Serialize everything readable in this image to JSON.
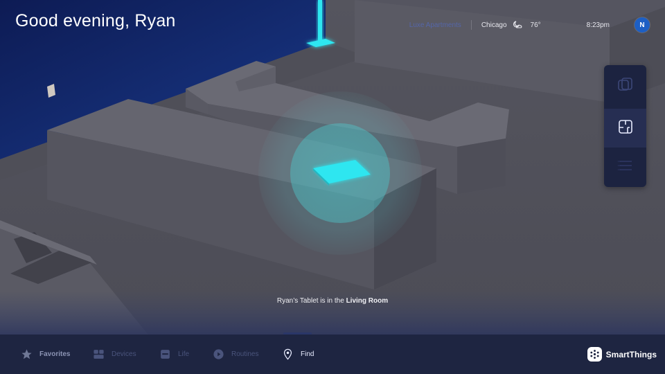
{
  "greeting": "Good evening, Ryan",
  "header": {
    "location": "Luxe Apartments",
    "city": "Chicago",
    "weather_icon": "moon-cloud-icon",
    "temperature": "76°",
    "time": "8:23pm",
    "avatar_initial": "N"
  },
  "side_panel": {
    "buttons": [
      {
        "icon": "layers-icon",
        "state": "dim"
      },
      {
        "icon": "floor-plan-icon",
        "state": "active"
      },
      {
        "icon": "list-icon",
        "state": "dim"
      }
    ]
  },
  "find": {
    "caption_prefix": "Ryan’s Tablet is in the",
    "room": "Living Room"
  },
  "nav": {
    "items": [
      {
        "label": "Favorites",
        "icon": "star-icon"
      },
      {
        "label": "Devices",
        "icon": "devices-icon"
      },
      {
        "label": "Life",
        "icon": "life-icon"
      },
      {
        "label": "Routines",
        "icon": "play-icon"
      },
      {
        "label": "Find",
        "icon": "location-pin-icon"
      }
    ],
    "selected": "Find"
  },
  "brand": {
    "name": "SmartThings"
  },
  "colors": {
    "accent_glow": "#2ee6f0",
    "nav_bg": "#1e2541",
    "panel_bg": "#1c2340",
    "avatar": "#1d5fc4"
  }
}
